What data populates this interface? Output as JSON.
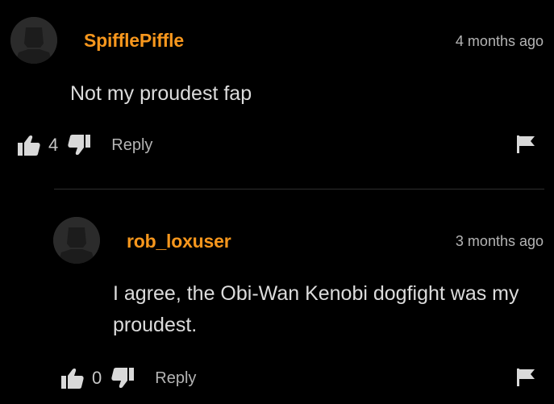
{
  "comments": [
    {
      "username": "SpifflePiffle",
      "timestamp": "4 months ago",
      "text": "Not my proudest fap",
      "vote_count": "4",
      "reply_label": "Reply"
    },
    {
      "username": "rob_loxuser",
      "timestamp": "3 months ago",
      "text": "I agree, the Obi-Wan Kenobi dogfight was my proudest.",
      "vote_count": "0",
      "reply_label": "Reply"
    }
  ],
  "colors": {
    "background": "#000000",
    "username": "#f7971d",
    "text": "#dcdcdc",
    "muted": "#b4b4b4"
  },
  "icons": [
    "avatar-placeholder",
    "thumbs-up-icon",
    "thumbs-down-icon",
    "flag-icon"
  ]
}
